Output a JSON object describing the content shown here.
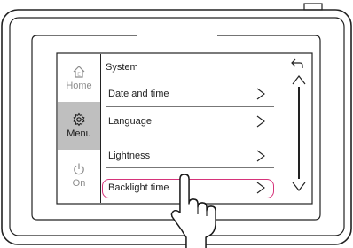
{
  "sidebar": {
    "items": [
      {
        "label": "Home",
        "icon": "home-icon",
        "state": "inactive"
      },
      {
        "label": "Menu",
        "icon": "gear-icon",
        "state": "active"
      },
      {
        "label": "On",
        "icon": "power-icon",
        "state": "inactive"
      }
    ]
  },
  "list": {
    "title": "System",
    "items": [
      {
        "label": "Date and time"
      },
      {
        "label": "Language"
      },
      {
        "label": "Lightness"
      },
      {
        "label": "Backlight time",
        "highlighted": true
      }
    ]
  },
  "colors": {
    "highlight": "#d6337a",
    "active_tab": "#bfbfbf",
    "inactive_text": "#8c8c8c"
  }
}
